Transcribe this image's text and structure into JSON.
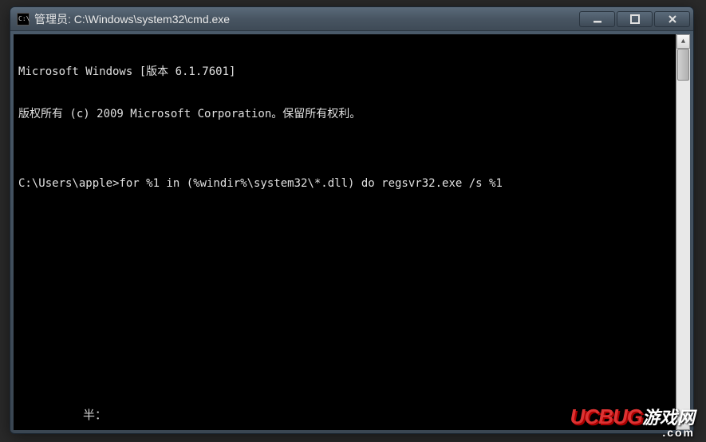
{
  "window": {
    "title": "管理员: C:\\Windows\\system32\\cmd.exe"
  },
  "console": {
    "line1": "Microsoft Windows [版本 6.1.7601]",
    "line2": "版权所有 (c) 2009 Microsoft Corporation。保留所有权利。",
    "blank": "",
    "prompt": "C:\\Users\\apple>for %1 in (%windir%\\system32\\*.dll) do regsvr32.exe /s %1"
  },
  "footer": {
    "label": "半："
  },
  "watermark": {
    "main": "UCBUG",
    "cn": "游戏网",
    "sub": ".com"
  }
}
